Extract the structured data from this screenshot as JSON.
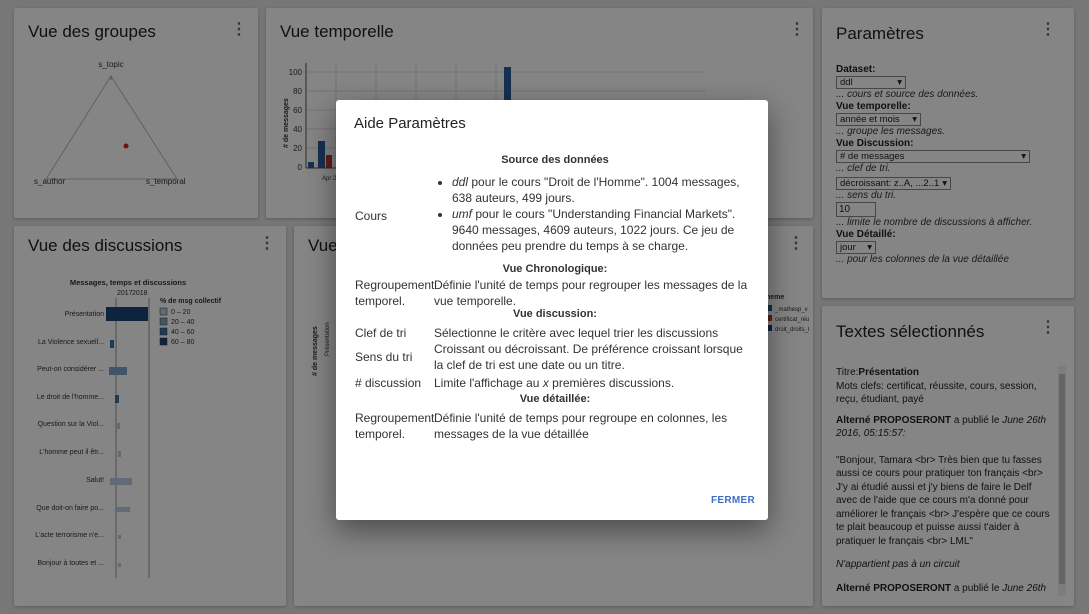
{
  "groups_panel": {
    "title": "Vue des groupes",
    "labels": {
      "top": "s_topic",
      "left": "s_author",
      "right": "s_temporal"
    }
  },
  "temporal_panel": {
    "title": "Vue temporelle",
    "ylabel": "# de messages",
    "yticks": [
      "100",
      "80",
      "60",
      "40",
      "20",
      "0"
    ],
    "xtick": "Apr 2"
  },
  "discussions_panel": {
    "title": "Vue des discussions",
    "chart_title": "Messages, temps et discussions",
    "years": [
      "2017",
      "2018"
    ],
    "legend_title": "% de msg collectif",
    "legend": [
      {
        "label": "0 – 20",
        "color": "#b9cde0"
      },
      {
        "label": "20 – 40",
        "color": "#7ea3c8"
      },
      {
        "label": "40 – 60",
        "color": "#3d6fa5"
      },
      {
        "label": "60 – 80",
        "color": "#1c4477"
      }
    ],
    "rows": [
      "Présentation",
      "La Violence sexuell...",
      "Peut-on considérer ...",
      "Le droit de l'homme...",
      "Question sur la Viol...",
      "L'homme peut il êtr...",
      "Salut!",
      "Que doit-on faire po...",
      "L'acte terrorisme n'e...",
      "Bonjour à toutes et ..."
    ]
  },
  "detail_panel": {
    "title": "Vue",
    "ylabel": "# de messages",
    "xlabel": "Présentation",
    "legend_title": "heme",
    "legend": [
      "_mathesp_v",
      "certificat_réu",
      "droit_droits_l"
    ]
  },
  "params_panel": {
    "title": "Paramètres",
    "dataset_label": "Dataset:",
    "dataset_value": "ddl",
    "dataset_help": "... cours et source des données.",
    "temporal_label": "Vue temporelle:",
    "temporal_value": "année et mois",
    "temporal_help": "... groupe les messages.",
    "discussion_label": "Vue Discussion:",
    "sort_key_value": "# de messages",
    "sort_key_help": "... clef de tri.",
    "sort_dir_value": "décroissant: z..A, ...2..1",
    "sort_dir_help": "... sens du tri.",
    "limit_value": "10",
    "limit_help": "... limite le nombre de discussions à afficher.",
    "detail_label": "Vue Détaillé:",
    "detail_value": "jour",
    "detail_help": "... pour les colonnes de la vue détaillée"
  },
  "texts_panel": {
    "title": "Textes sélectionnés",
    "titre_prefix": "Titre:",
    "titre_value": "Présentation",
    "keywords": "Mots clefs: certificat, réussite, cours, session, reçu, étudiant, payé",
    "author": "Alterné PROPOSERONT",
    "published": "a publié le",
    "date": "June 26th 2016, 05:15:57:",
    "message": "\"Bonjour, Tamara <br> Très bien que tu fasses aussi ce cours pour pratiquer ton français <br> J'y ai étudié aussi et j'y biens de faire le Delf avec de l'aide que ce cours m'a donné pour améliorer le français <br> J'espère que ce cours te plait beaucoup et puisse aussi t'aider à pratiquer le français <br> LML\"",
    "circuit": "N'appartient pas à un circuit",
    "author2": "Alterné PROPOSERONT",
    "published2": "a publié le",
    "date2": "June 26th"
  },
  "dialog": {
    "title": "Aide Paramètres",
    "source_heading": "Source des données",
    "cours_label": "Cours",
    "cours_ddl_name": "ddl",
    "cours_ddl_text": " pour le cours \"Droit de l'Homme\". 1004 messages, 638 auteurs, 499 jours.",
    "cours_umf_name": "umf",
    "cours_umf_text": " pour le cours \"Understanding Financial Markets\". 9640 messages, 4609 auteurs, 1022 jours. Ce jeu de données peu prendre du temps à se charge.",
    "chrono_heading": "Vue Chronologique:",
    "regroup_label": "Regroupement temporel.",
    "regroup_text": "Définie l'unité de temps pour regrouper les messages de la vue temporelle.",
    "discussion_heading": "Vue discussion:",
    "clef_label": "Clef de tri",
    "clef_text": "Sélectionne le critère avec lequel trier les discussions",
    "sens_label": "Sens du tri",
    "sens_text": "Croissant ou décroissant. De préférence croissant lorsque la clef de tri est une date ou un titre.",
    "count_label": "# discussion",
    "count_text_a": "Limite l'affichage au ",
    "count_text_x": "x",
    "count_text_b": " premières discussions.",
    "detail_heading": "Vue détaillée:",
    "regroup2_label": "Regroupement temporel.",
    "regroup2_text": "Définie l'unité de temps pour regroupe en colonnes, les messages de la vue détaillée",
    "close_label": "FERMER"
  }
}
